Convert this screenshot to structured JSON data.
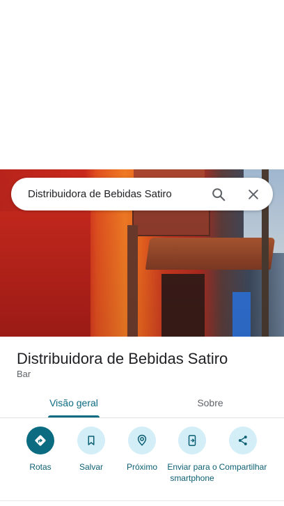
{
  "search": {
    "value": "Distribuidora de Bebidas Satiro"
  },
  "place": {
    "title": "Distribuidora de Bebidas Satiro",
    "category": "Bar"
  },
  "tabs": [
    {
      "label": "Visão geral",
      "active": true
    },
    {
      "label": "Sobre",
      "active": false
    }
  ],
  "actions": [
    {
      "label": "Rotas",
      "icon": "directions-icon"
    },
    {
      "label": "Salvar",
      "icon": "bookmark-icon"
    },
    {
      "label": "Próximo",
      "icon": "nearby-icon"
    },
    {
      "label": "Enviar para o smartphone",
      "icon": "send-to-phone-icon"
    },
    {
      "label": "Compartilhar",
      "icon": "share-icon"
    }
  ],
  "colors": {
    "accent": "#0b6b80",
    "action_bg": "#d3eef7"
  }
}
